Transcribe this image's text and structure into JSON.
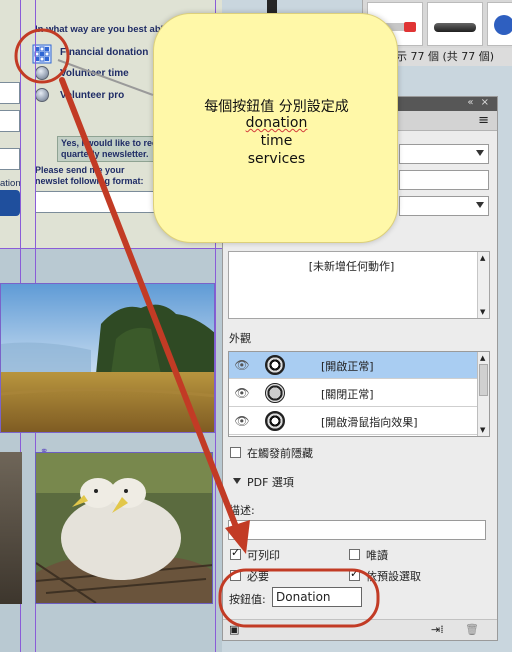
{
  "document": {
    "question": "In what way are you best able to",
    "options": [
      "Financial donation",
      "Volunteer time",
      "Volunteer pro"
    ],
    "left_fragment": "ation",
    "newsletter_checkbox_text": "Yes, I would like to rece quarterly newsletter.",
    "format_prompt": "Please send me your newslet following format:"
  },
  "top_strip": {
    "counter_text": "示 77 個 (共 77 個)"
  },
  "callout": {
    "lines": [
      "每個按鈕值 分別設定成",
      "donation",
      "time",
      "services"
    ]
  },
  "panel": {
    "titlebar_controls": "«  ×",
    "menu_icon": "≡",
    "actions_placeholder": "[未新增任何動作]",
    "appearance": {
      "label": "外觀",
      "rows": [
        {
          "label": "[開啟正常]",
          "selected": true
        },
        {
          "label": "[關閉正常]",
          "selected": false
        },
        {
          "label": "[開啟滑鼠指向效果]",
          "selected": false
        }
      ]
    },
    "hide_until_triggered": {
      "label": "在觸發前隱藏",
      "checked": false
    },
    "pdf_options": {
      "label": "PDF 選項"
    },
    "description_label": "描述:",
    "description_value": "",
    "printable": {
      "label": "可列印",
      "checked": true
    },
    "readonly": {
      "label": "唯讀",
      "checked": false
    },
    "required": {
      "label": "必要",
      "checked": false
    },
    "selected_by_default": {
      "label": "依預設選取",
      "checked": true
    },
    "button_value": {
      "label": "按鈕值:",
      "value": "Donation"
    }
  },
  "colors": {
    "callout_fill": "#fff8a8",
    "annotation_red": "#c23b25",
    "selection_blue": "#a9cdf2",
    "guide_purple": "#8a5cd8",
    "submit_blue": "#1f4f9d"
  }
}
